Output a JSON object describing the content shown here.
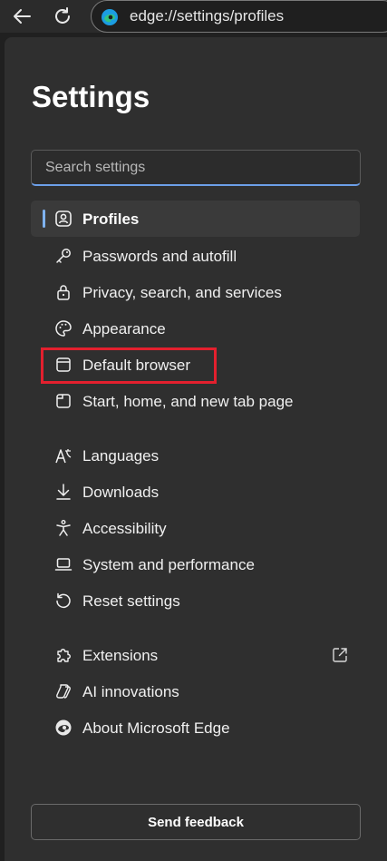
{
  "browser": {
    "address": "edge://settings/profiles",
    "icons": {
      "back": "back-arrow-icon",
      "refresh": "refresh-icon",
      "site": "edge-logo-icon"
    }
  },
  "settings": {
    "title": "Settings",
    "search_placeholder": "Search settings",
    "accent_color": "#7fb2f0",
    "highlight_color": "#e3202e",
    "nav_groups": [
      [
        {
          "label": "Profiles",
          "icon": "profile-icon",
          "selected": true
        },
        {
          "label": "Passwords and autofill",
          "icon": "key-icon"
        },
        {
          "label": "Privacy, search, and services",
          "icon": "lock-icon"
        },
        {
          "label": "Appearance",
          "icon": "palette-icon"
        },
        {
          "label": "Default browser",
          "icon": "browser-window-icon",
          "highlighted": true
        },
        {
          "label": "Start, home, and new tab page",
          "icon": "home-page-icon"
        }
      ],
      [
        {
          "label": "Languages",
          "icon": "languages-icon"
        },
        {
          "label": "Downloads",
          "icon": "download-icon"
        },
        {
          "label": "Accessibility",
          "icon": "accessibility-icon"
        },
        {
          "label": "System and performance",
          "icon": "laptop-icon"
        },
        {
          "label": "Reset settings",
          "icon": "reset-icon"
        }
      ],
      [
        {
          "label": "Extensions",
          "icon": "puzzle-icon",
          "external": true
        },
        {
          "label": "AI innovations",
          "icon": "ai-icon"
        },
        {
          "label": "About Microsoft Edge",
          "icon": "edge-logo-icon"
        }
      ]
    ],
    "feedback_label": "Send feedback"
  }
}
